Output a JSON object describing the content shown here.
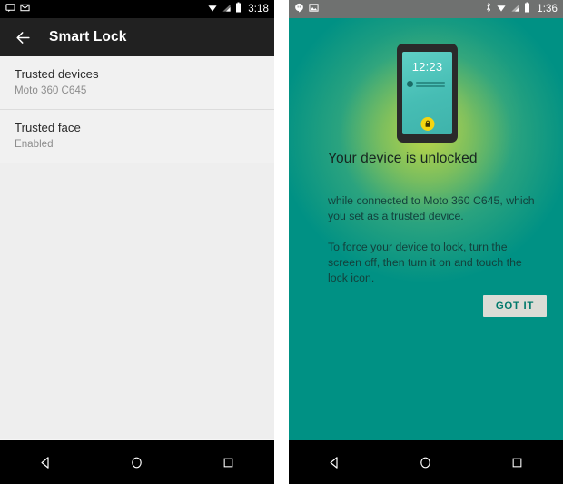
{
  "left_phone": {
    "status_bar": {
      "icons": [
        "message-icon",
        "gmail-icon"
      ],
      "right_icons": [
        "wifi-icon",
        "signal-icon",
        "battery-icon"
      ],
      "time": "3:18"
    },
    "app_bar": {
      "back_icon": "back-arrow-icon",
      "title": "Smart Lock"
    },
    "list": [
      {
        "title": "Trusted devices",
        "subtitle": "Moto 360 C645"
      },
      {
        "title": "Trusted face",
        "subtitle": "Enabled"
      }
    ],
    "nav_bar": {
      "back": "back-triangle-icon",
      "home": "home-circle-icon",
      "recents": "recents-square-icon"
    }
  },
  "right_phone": {
    "status_bar": {
      "icons": [
        "hangouts-icon",
        "photos-icon"
      ],
      "right_icons": [
        "bluetooth-icon",
        "wifi-icon",
        "signal-icon",
        "battery-icon"
      ],
      "time": "1:36"
    },
    "device_illustration": {
      "clock": "12:23",
      "lock_icon": "padlock-icon"
    },
    "heading": "Your device is unlocked",
    "paragraph_1": "while connected to Moto 360 C645, which you set as a trusted device.",
    "paragraph_2": "To force your device to lock, turn the screen off, then turn it on and touch the lock icon.",
    "got_it_label": "GOT IT",
    "nav_bar": {
      "back": "back-triangle-icon",
      "home": "home-circle-icon",
      "recents": "recents-square-icon"
    }
  },
  "colors": {
    "teal": "#009184",
    "app_bar": "#212121",
    "list_bg": "#eeeeee",
    "button_bg": "#dcdcd6",
    "button_text": "#00796b",
    "lock_yellow": "#f5d511"
  }
}
